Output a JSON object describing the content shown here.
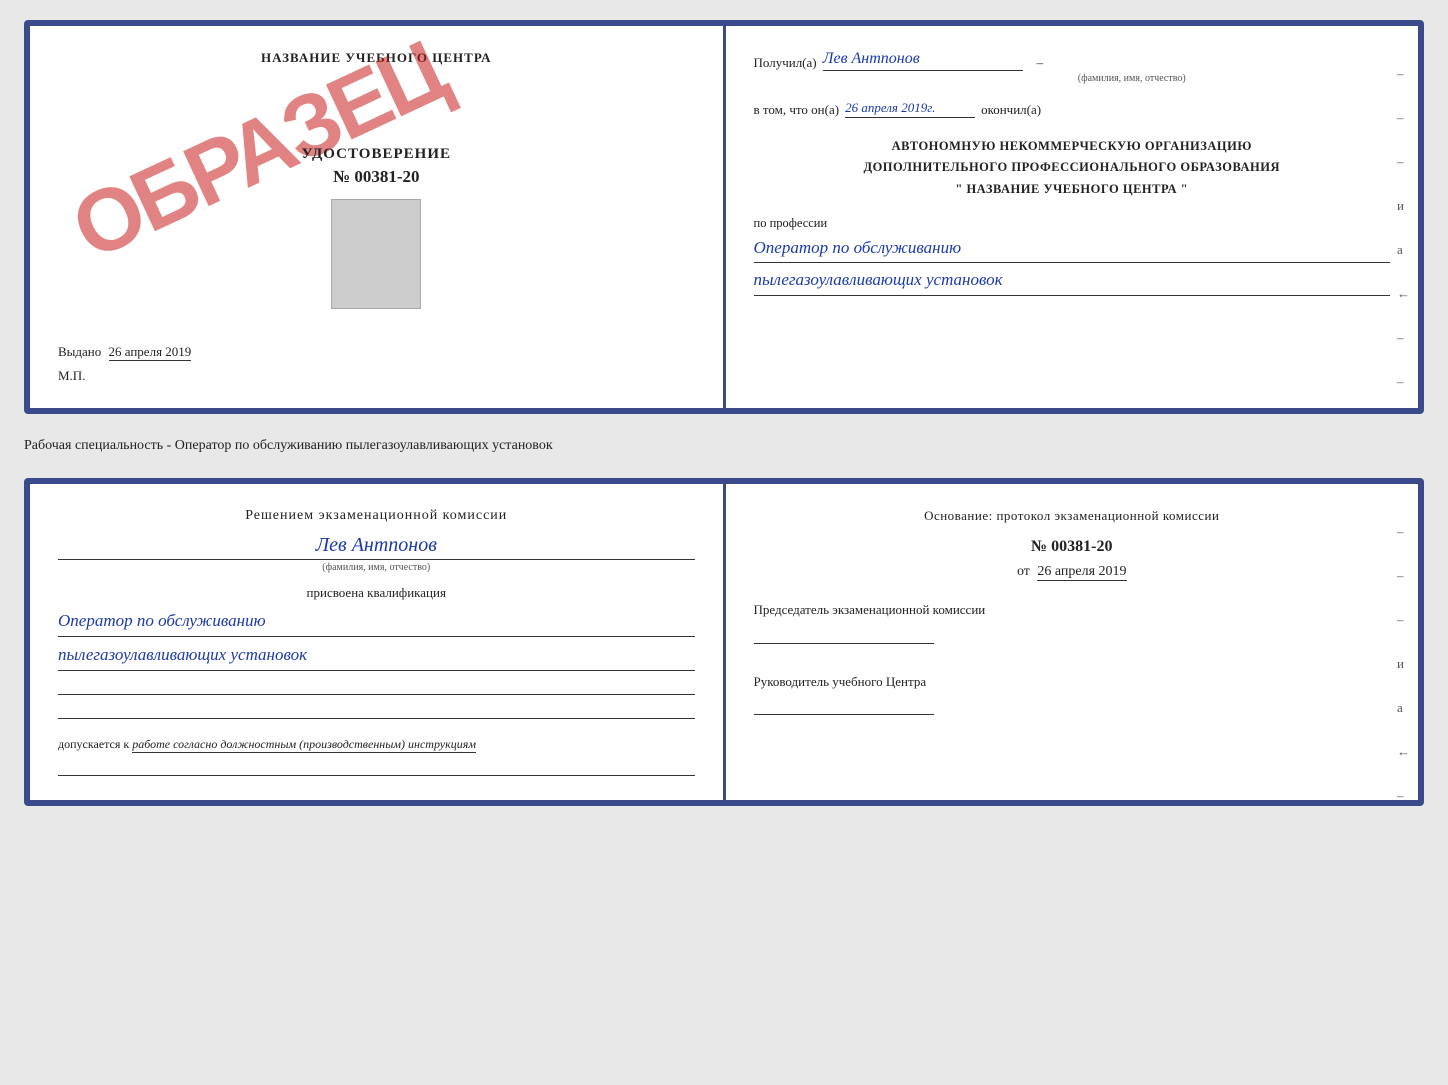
{
  "top_doc": {
    "left": {
      "title": "НАЗВАНИЕ УЧЕБНОГО ЦЕНТРА",
      "obrazec": "ОБРАЗЕЦ",
      "udostoverenie_label": "УДОСТОВЕРЕНИЕ",
      "udostoverenie_num": "№ 00381-20",
      "vydano": "Выдано",
      "vydano_date": "26 апреля 2019",
      "mp": "М.П."
    },
    "right": {
      "poluchil_label": "Получил(а)",
      "poluchil_name": "Лев Антпонов",
      "fio_hint": "(фамилия, имя, отчество)",
      "vtom_label": "в том, что он(а)",
      "vtom_date": "26 апреля 2019г.",
      "okonchil": "окончил(а)",
      "org_line1": "АВТОНОМНУЮ НЕКОММЕРЧЕСКУЮ ОРГАНИЗАЦИЮ",
      "org_line2": "ДОПОЛНИТЕЛЬНОГО ПРОФЕССИОНАЛЬНОГО ОБРАЗОВАНИЯ",
      "org_line3": "\" НАЗВАНИЕ УЧЕБНОГО ЦЕНТРА \"",
      "po_professii": "по профессии",
      "profession1": "Оператор по обслуживанию",
      "profession2": "пылегазоулавливающих установок"
    }
  },
  "middle": {
    "text": "Рабочая специальность - Оператор по обслуживанию пылегазоулавливающих установок"
  },
  "bottom_doc": {
    "left": {
      "resheniem_label": "Решением экзаменационной комиссии",
      "person_name": "Лев Антпонов",
      "fio_hint": "(фамилия, имя, отчество)",
      "prisvoyena": "присвоена квалификация",
      "kvalf1": "Оператор по обслуживанию",
      "kvalf2": "пылегазоулавливающих установок",
      "dopuskaetsya": "допускается к",
      "dopusk_text": "работе согласно должностным (производственным) инструкциям"
    },
    "right": {
      "osnovanie_label": "Основание: протокол экзаменационной комиссии",
      "prot_num": "№ 00381-20",
      "ot_label": "от",
      "ot_date": "26 апреля 2019",
      "predsedatel_label": "Председатель экзаменационной комиссии",
      "rukovoditel_label": "Руководитель учебного Центра"
    }
  },
  "dashes": [
    "-",
    "-",
    "-",
    "и",
    "а",
    "←",
    "-",
    "-",
    "-",
    "-",
    "-"
  ]
}
